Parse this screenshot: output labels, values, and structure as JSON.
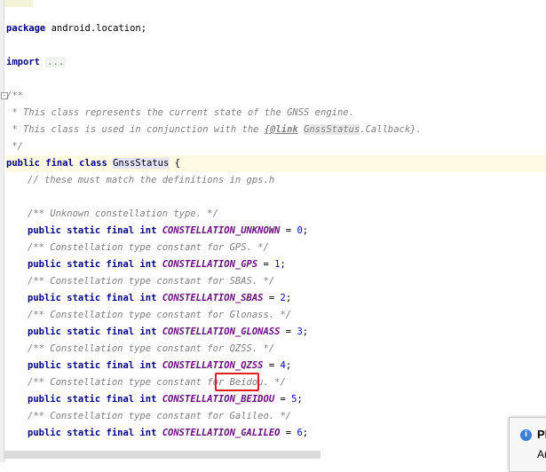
{
  "editor": {
    "package_kw": "package",
    "package_name": "android.location;",
    "import_kw": "import",
    "import_fold": "...",
    "doc_open": "/**",
    "doc_line1": " * This class represents the current state of the GNSS engine.",
    "doc_line2_a": " * This class is used in conjunction with the ",
    "doc_line2_tag": "{@link",
    "doc_line2_space": " ",
    "doc_line2_ref": "GnssStatus",
    "doc_line2_b": ".Callback}.",
    "doc_close": " */",
    "class_modifiers": "public final class ",
    "class_name": "GnssStatus",
    "class_brace": " {",
    "comment_defs": "// these must match the definitions in gps.h",
    "decl_prefix": "public static final int ",
    "constants": [
      {
        "comment": "/** Unknown constellation type. */",
        "name": "CONSTELLATION_UNKNOWN",
        "value": "0"
      },
      {
        "comment": "/** Constellation type constant for GPS. */",
        "name": "CONSTELLATION_GPS",
        "value": "1"
      },
      {
        "comment": "/** Constellation type constant for SBAS. */",
        "name": "CONSTELLATION_SBAS",
        "value": "2"
      },
      {
        "comment": "/** Constellation type constant for Glonass. */",
        "name": "CONSTELLATION_GLONASS",
        "value": "3"
      },
      {
        "comment": "/** Constellation type constant for QZSS. */",
        "name": "CONSTELLATION_QZSS",
        "value": "4"
      },
      {
        "comment": "/** Constellation type constant for Beidou. */",
        "name": "CONSTELLATION_BEIDOU",
        "value": "5"
      },
      {
        "comment": "/** Constellation type constant for Galileo. */",
        "name": "CONSTELLATION_GALILEO",
        "value": "6"
      }
    ]
  },
  "notification": {
    "title": "Pl",
    "body": "An"
  }
}
